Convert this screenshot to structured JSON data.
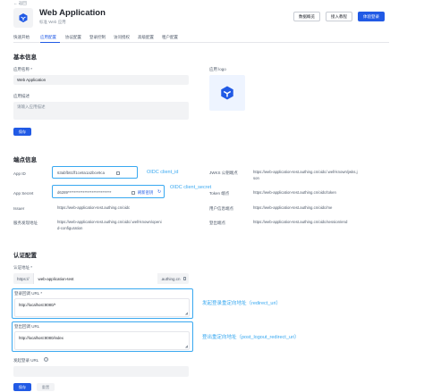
{
  "header": {
    "back_label": "← 返回",
    "app_name": "Web Application",
    "app_subtitle": "标准 Web 应用",
    "buttons": {
      "overview": "数据概览",
      "tutorial": "接入教程",
      "experience_login": "体验登录"
    }
  },
  "tabs": [
    "快速开始",
    "应用配置",
    "协议配置",
    "登录控制",
    "访问授权",
    "高级配置",
    "租户配置"
  ],
  "basic_info": {
    "title": "基本信息",
    "name_label": "应用名称 *",
    "name_value": "Web Application",
    "desc_label": "应用描述",
    "desc_placeholder": "请输入应用描述",
    "logo_label": "应用 logo",
    "save": "保存"
  },
  "endpoints": {
    "title": "端点信息",
    "app_id_label": "App ID",
    "app_id_value": "63abfb61ff1ce8a1a2bce9ca",
    "app_secret_label": "App Secret",
    "app_secret_value": "d6289*****************************",
    "refresh_label": "刷新密钥",
    "issuer_label": "Issuer",
    "issuer_value": "https://web-application-test.authing.cn/oidc",
    "discovery_label": "服务发现地址",
    "discovery_line1": "https://web-application-test.authing.cn/oidc/.well-known/openi",
    "discovery_line2": "d-configuration",
    "jwks_label": "JWKS 公钥端点",
    "jwks_line1": "https://web-application-test.authing.cn/oidc/.well-known/jwks.j",
    "jwks_line2": "son",
    "token_label": "Token 端点",
    "token_value": "https://web-application-test.authing.cn/oidc/token",
    "userinfo_label": "用户信息端点",
    "userinfo_value": "https://web-application-test.authing.cn/oidc/me",
    "logout_label": "登出端点",
    "logout_value": "https://web-application-test.authing.cn/oidc/session/end"
  },
  "annotations": {
    "client_id": "OIDC client_id",
    "client_secret": "OIDC client_secret",
    "redirect_uri": "发起登录重定向地址（redirect_uri）",
    "post_logout": "登出重定向地址（post_logout_redirect_uri）"
  },
  "auth_config": {
    "title": "认证配置",
    "auth_addr_label": "认证地址 *",
    "protocol": "https://",
    "domain_value": "web-application-test",
    "domain_suffix": ".authing.cn",
    "login_callback_label": "登录回调 URL *",
    "login_callback_value": "http://localhost:8080/*",
    "logout_callback_label": "登出回调 URL",
    "logout_callback_value": "http://localhost:8080/index",
    "init_login_label": "发起登录 URL",
    "save": "保存",
    "reset": "重置"
  },
  "colors": {
    "primary": "#215ae5",
    "annotation": "#38a8f0",
    "input_bg": "#f2f3f5"
  }
}
